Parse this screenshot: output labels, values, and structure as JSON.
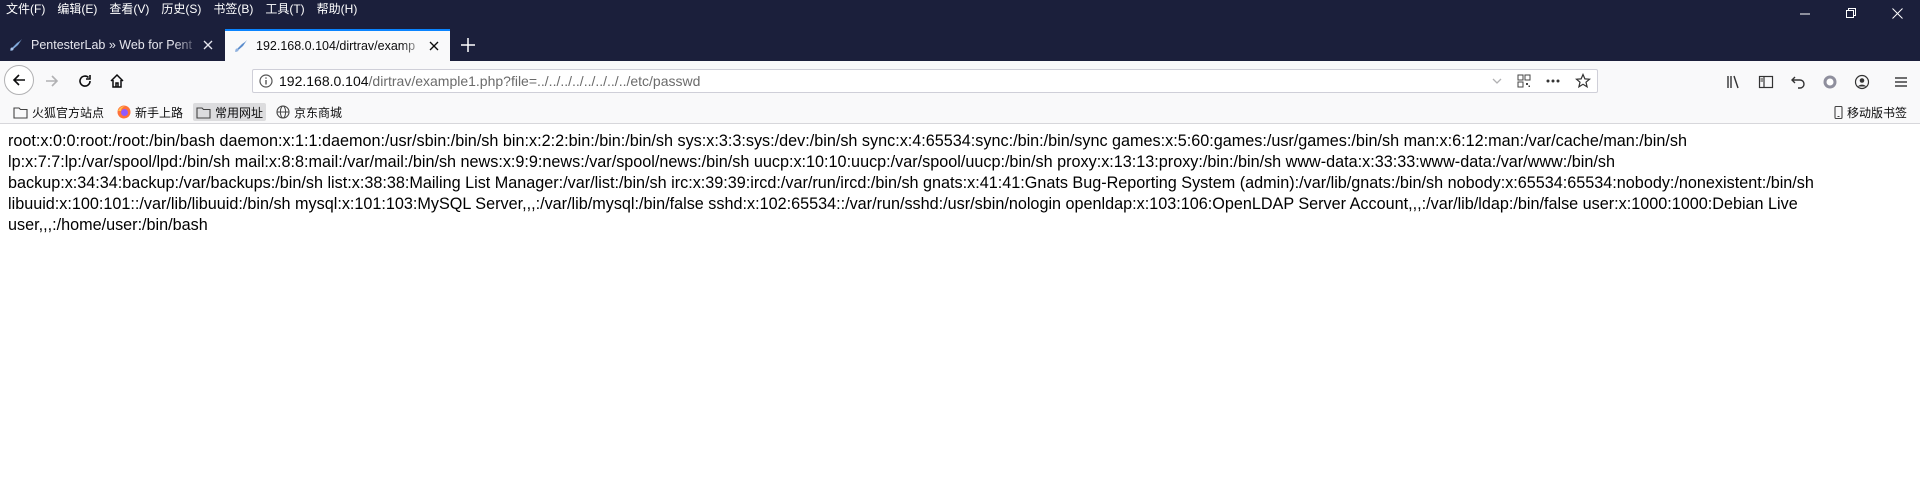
{
  "menu": [
    "文件(F)",
    "编辑(E)",
    "查看(V)",
    "历史(S)",
    "书签(B)",
    "工具(T)",
    "帮助(H)"
  ],
  "window_controls": {
    "minimize": "—",
    "maximize": "❐",
    "close": "✕"
  },
  "tabs": [
    {
      "title": "PentesterLab » Web for Pent",
      "active": false,
      "icon": "pentesterlab-icon"
    },
    {
      "title": "192.168.0.104/dirtrav/examp",
      "active": true,
      "icon": "page-icon"
    }
  ],
  "new_tab_label": "+",
  "address": {
    "host": "192.168.0.104",
    "path": "/dirtrav/example1.php?file=../../../../../../../../etc/passwd"
  },
  "bookmarks": [
    {
      "label": "火狐官方站点",
      "icon": "folder-icon"
    },
    {
      "label": "新手上路",
      "icon": "firefox-icon"
    },
    {
      "label": "常用网址",
      "icon": "folder-icon"
    },
    {
      "label": "京东商城",
      "icon": "globe-icon"
    }
  ],
  "mobile_bookmarks": "移动版书签",
  "page_text": "root:x:0:0:root:/root:/bin/bash daemon:x:1:1:daemon:/usr/sbin:/bin/sh bin:x:2:2:bin:/bin:/bin/sh sys:x:3:3:sys:/dev:/bin/sh sync:x:4:65534:sync:/bin:/bin/sync games:x:5:60:games:/usr/games:/bin/sh man:x:6:12:man:/var/cache/man:/bin/sh lp:x:7:7:lp:/var/spool/lpd:/bin/sh mail:x:8:8:mail:/var/mail:/bin/sh news:x:9:9:news:/var/spool/news:/bin/sh uucp:x:10:10:uucp:/var/spool/uucp:/bin/sh proxy:x:13:13:proxy:/bin:/bin/sh www-data:x:33:33:www-data:/var/www:/bin/sh backup:x:34:34:backup:/var/backups:/bin/sh list:x:38:38:Mailing List Manager:/var/list:/bin/sh irc:x:39:39:ircd:/var/run/ircd:/bin/sh gnats:x:41:41:Gnats Bug-Reporting System (admin):/var/lib/gnats:/bin/sh nobody:x:65534:65534:nobody:/nonexistent:/bin/sh libuuid:x:100:101::/var/lib/libuuid:/bin/sh mysql:x:101:103:MySQL Server,,,:/var/lib/mysql:/bin/false sshd:x:102:65534::/var/run/sshd:/usr/sbin/nologin openldap:x:103:106:OpenLDAP Server Account,,,:/var/lib/ldap:/bin/false user:x:1000:1000:Debian Live user,,,:/home/user:/bin/bash",
  "colors": {
    "titlebar": "#1b1f3b",
    "active_tab_accent": "#0a84ff",
    "toolbar": "#f9f9fa"
  }
}
